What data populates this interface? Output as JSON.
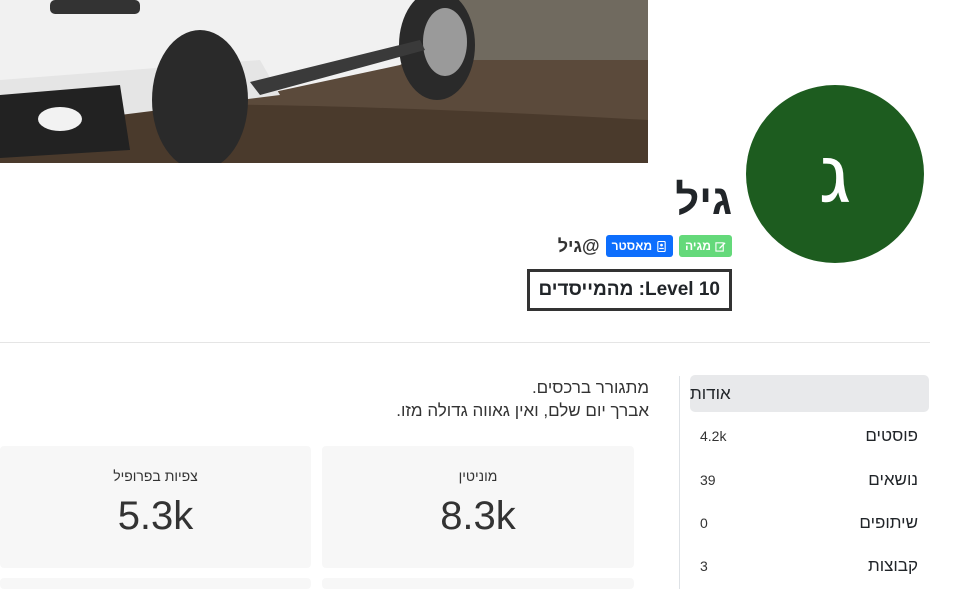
{
  "profile": {
    "avatar_letter": "ג",
    "avatar_color": "#1d5c1f",
    "fullname": "גיל",
    "handle": "@גיל",
    "badges": [
      {
        "label": "מאסטר",
        "icon": "id-card-icon",
        "color": "#0d6efd"
      },
      {
        "label": "מגיה",
        "icon": "edit-icon",
        "color": "#64d97a"
      }
    ],
    "level_text": "Level 10: מהמייסדים",
    "bio_lines": [
      "מתגורר ברכסים.",
      "אברך יום שלם, ואין גאווה גדולה מזו."
    ]
  },
  "sidebar": {
    "active_item": "אודות",
    "stats": [
      {
        "label": "פוסטים",
        "value": "4.2k"
      },
      {
        "label": "נושאים",
        "value": "39"
      },
      {
        "label": "שיתופים",
        "value": "0"
      },
      {
        "label": "קבוצות",
        "value": "3"
      }
    ]
  },
  "cards": [
    {
      "label": "מוניטין",
      "value": "8.3k"
    },
    {
      "label": "צפיות בפרופיל",
      "value": "5.3k"
    }
  ]
}
